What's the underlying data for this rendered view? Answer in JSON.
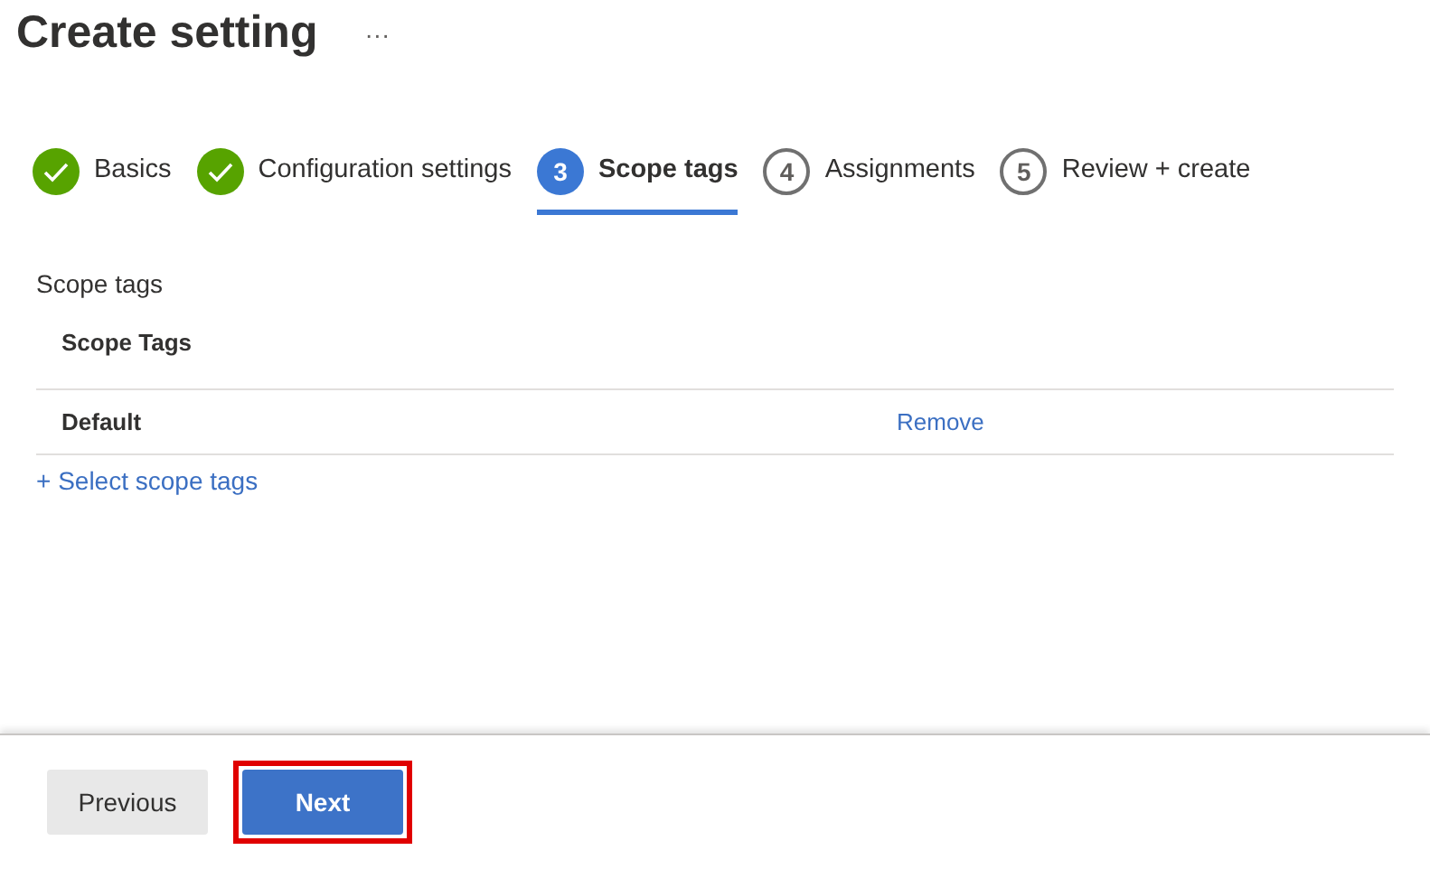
{
  "header": {
    "title": "Create setting",
    "more": "···"
  },
  "steps": [
    {
      "label": "Basics",
      "completed": true,
      "selected": false
    },
    {
      "label": "Configuration settings",
      "completed": true,
      "selected": false
    },
    {
      "label": "Scope tags",
      "number": "3",
      "completed": false,
      "selected": true
    },
    {
      "label": "Assignments",
      "number": "4",
      "completed": false,
      "selected": false
    },
    {
      "label": "Review + create",
      "number": "5",
      "completed": false,
      "selected": false
    }
  ],
  "section": {
    "title": "Scope tags",
    "table": {
      "columns": [
        "Scope Tags"
      ],
      "rows": [
        {
          "name": "Default",
          "action": "Remove"
        }
      ]
    },
    "add_link": "+ Select scope tags"
  },
  "footer": {
    "buttons": [
      {
        "label": "Previous",
        "kind": "secondary",
        "highlighted": false
      },
      {
        "label": "Next",
        "kind": "primary",
        "highlighted": true
      }
    ]
  }
}
